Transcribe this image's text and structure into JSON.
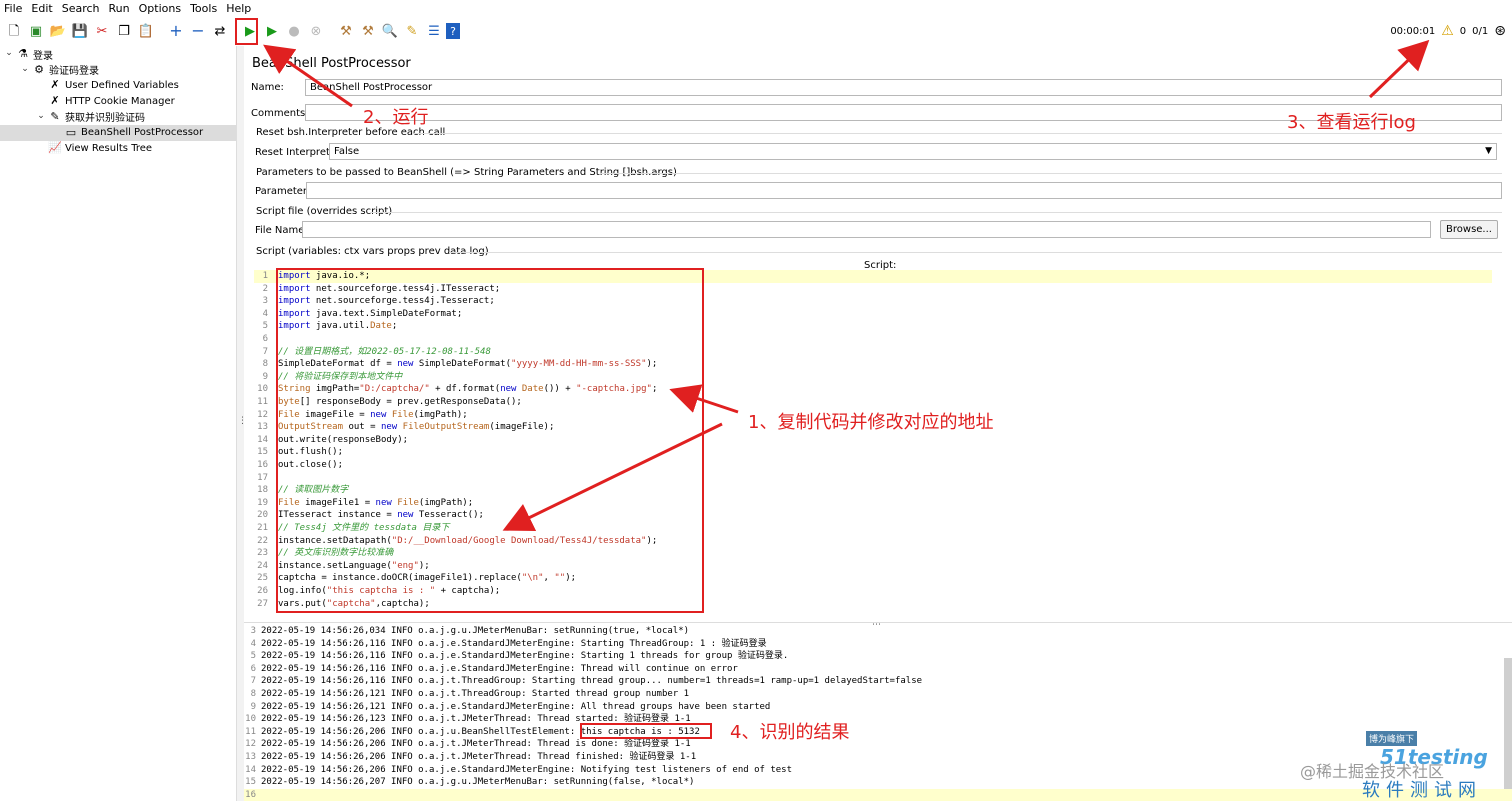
{
  "menu": [
    "File",
    "Edit",
    "Search",
    "Run",
    "Options",
    "Tools",
    "Help"
  ],
  "toolbar": {
    "icons": [
      "new-icon",
      "templates-icon",
      "open-icon",
      "save-icon",
      "cut-icon",
      "copy-icon",
      "paste-icon",
      "expand-icon",
      "collapse-icon",
      "toggle-icon",
      "run-icon",
      "run-no-pause-icon",
      "stop-icon",
      "shutdown-icon",
      "clear-icon",
      "clear-all-icon",
      "search-icon",
      "reset-search-icon",
      "function-helper-icon",
      "help-icon"
    ],
    "timer": "00:00:01",
    "warnings": "0",
    "threads": "0/1"
  },
  "tree": [
    {
      "label": "登录",
      "icon": "test-plan-icon",
      "depth": 0
    },
    {
      "label": "验证码登录",
      "icon": "thread-group-icon",
      "depth": 1
    },
    {
      "label": "User Defined Variables",
      "icon": "config-element-icon",
      "depth": 2
    },
    {
      "label": "HTTP Cookie Manager",
      "icon": "config-element-icon",
      "depth": 2
    },
    {
      "label": "获取并识别验证码",
      "icon": "sampler-icon",
      "depth": 2
    },
    {
      "label": "BeanShell PostProcessor",
      "icon": "post-processor-icon",
      "depth": 3,
      "selected": true
    },
    {
      "label": "View Results Tree",
      "icon": "listener-icon",
      "depth": 2
    }
  ],
  "panel": {
    "title": "BeanShell PostProcessor",
    "name_label": "Name:",
    "name_value": "BeanShell PostProcessor",
    "comments_label": "Comments:",
    "comments_value": "",
    "reset_group": "Reset bsh.Interpreter before each call",
    "reset_label": "Reset Interpreter:",
    "reset_value": "False",
    "params_group": "Parameters to be passed to BeanShell (=> String Parameters and String []bsh.args)",
    "params_label": "Parameters:",
    "params_value": "",
    "scriptfile_group": "Script file (overrides script)",
    "filename_label": "File Name:",
    "filename_value": "",
    "browse_label": "Browse...",
    "script_group": "Script (variables: ctx vars props prev data log)",
    "script_label": "Script:"
  },
  "script_lines": [
    "import java.io.*;",
    "import net.sourceforge.tess4j.ITesseract;",
    "import net.sourceforge.tess4j.Tesseract;",
    "import java.text.SimpleDateFormat;",
    "import java.util.Date;",
    "",
    "// 设置日期格式，如2022-05-17-12-08-11-548",
    "SimpleDateFormat df = new SimpleDateFormat(\"yyyy-MM-dd-HH-mm-ss-SSS\");",
    "// 将验证码保存到本地文件中",
    "String imgPath=\"D:/captcha/\" + df.format(new Date()) + \"-captcha.jpg\";",
    "byte[] responseBody = prev.getResponseData();",
    "File imageFile = new File(imgPath);",
    "OutputStream out = new FileOutputStream(imageFile);",
    "out.write(responseBody);",
    "out.flush();",
    "out.close();",
    "",
    "// 读取图片数字",
    "File imageFile1 = new File(imgPath);",
    "ITesseract instance = new Tesseract();",
    "// Tess4j 文件里的 tessdata 目录下",
    "instance.setDatapath(\"D:/__Download/Google Download/Tess4J/tessdata\");",
    "// 英文库识别数字比较准确",
    "instance.setLanguage(\"eng\");",
    "captcha = instance.doOCR(imageFile1).replace(\"\\n\", \"\");",
    "log.info(\"this captcha is : \" + captcha);",
    "vars.put(\"captcha\",captcha);"
  ],
  "log_lines": [
    {
      "n": "3",
      "t": "2022-05-19 14:56:26,034 INFO o.a.j.g.u.JMeterMenuBar: setRunning(true, *local*)"
    },
    {
      "n": "4",
      "t": "2022-05-19 14:56:26,116 INFO o.a.j.e.StandardJMeterEngine: Starting ThreadGroup: 1 : 验证码登录"
    },
    {
      "n": "5",
      "t": "2022-05-19 14:56:26,116 INFO o.a.j.e.StandardJMeterEngine: Starting 1 threads for group 验证码登录."
    },
    {
      "n": "6",
      "t": "2022-05-19 14:56:26,116 INFO o.a.j.e.StandardJMeterEngine: Thread will continue on error"
    },
    {
      "n": "7",
      "t": "2022-05-19 14:56:26,116 INFO o.a.j.t.ThreadGroup: Starting thread group... number=1 threads=1 ramp-up=1 delayedStart=false"
    },
    {
      "n": "8",
      "t": "2022-05-19 14:56:26,121 INFO o.a.j.t.ThreadGroup: Started thread group number 1"
    },
    {
      "n": "9",
      "t": "2022-05-19 14:56:26,121 INFO o.a.j.e.StandardJMeterEngine: All thread groups have been started"
    },
    {
      "n": "10",
      "t": "2022-05-19 14:56:26,123 INFO o.a.j.t.JMeterThread: Thread started: 验证码登录 1-1"
    },
    {
      "n": "11",
      "t": "2022-05-19 14:56:26,206 INFO o.a.j.u.BeanShellTestElement: this captcha is : 5132"
    },
    {
      "n": "12",
      "t": "2022-05-19 14:56:26,206 INFO o.a.j.t.JMeterThread: Thread is done: 验证码登录 1-1"
    },
    {
      "n": "13",
      "t": "2022-05-19 14:56:26,206 INFO o.a.j.t.JMeterThread: Thread finished: 验证码登录 1-1"
    },
    {
      "n": "14",
      "t": "2022-05-19 14:56:26,206 INFO o.a.j.e.StandardJMeterEngine: Notifying test listeners of end of test"
    },
    {
      "n": "15",
      "t": "2022-05-19 14:56:26,207 INFO o.a.j.g.u.JMeterMenuBar: setRunning(false, *local*)"
    },
    {
      "n": "16",
      "t": ""
    }
  ],
  "annotations": {
    "a1": "1、复制代码并修改对应的地址",
    "a2": "2、运行",
    "a3": "3、查看运行log",
    "a4": "4、识别的结果"
  },
  "watermark": {
    "line1": "@稀土掘金技术社区",
    "line2": "软件测试网",
    "badge": "博为峰旗下",
    "brand": "51testing"
  },
  "colors": {
    "annotation": "#e02020",
    "keyword": "#0000c8",
    "string": "#c0392b",
    "comment": "#3a9a3a"
  }
}
